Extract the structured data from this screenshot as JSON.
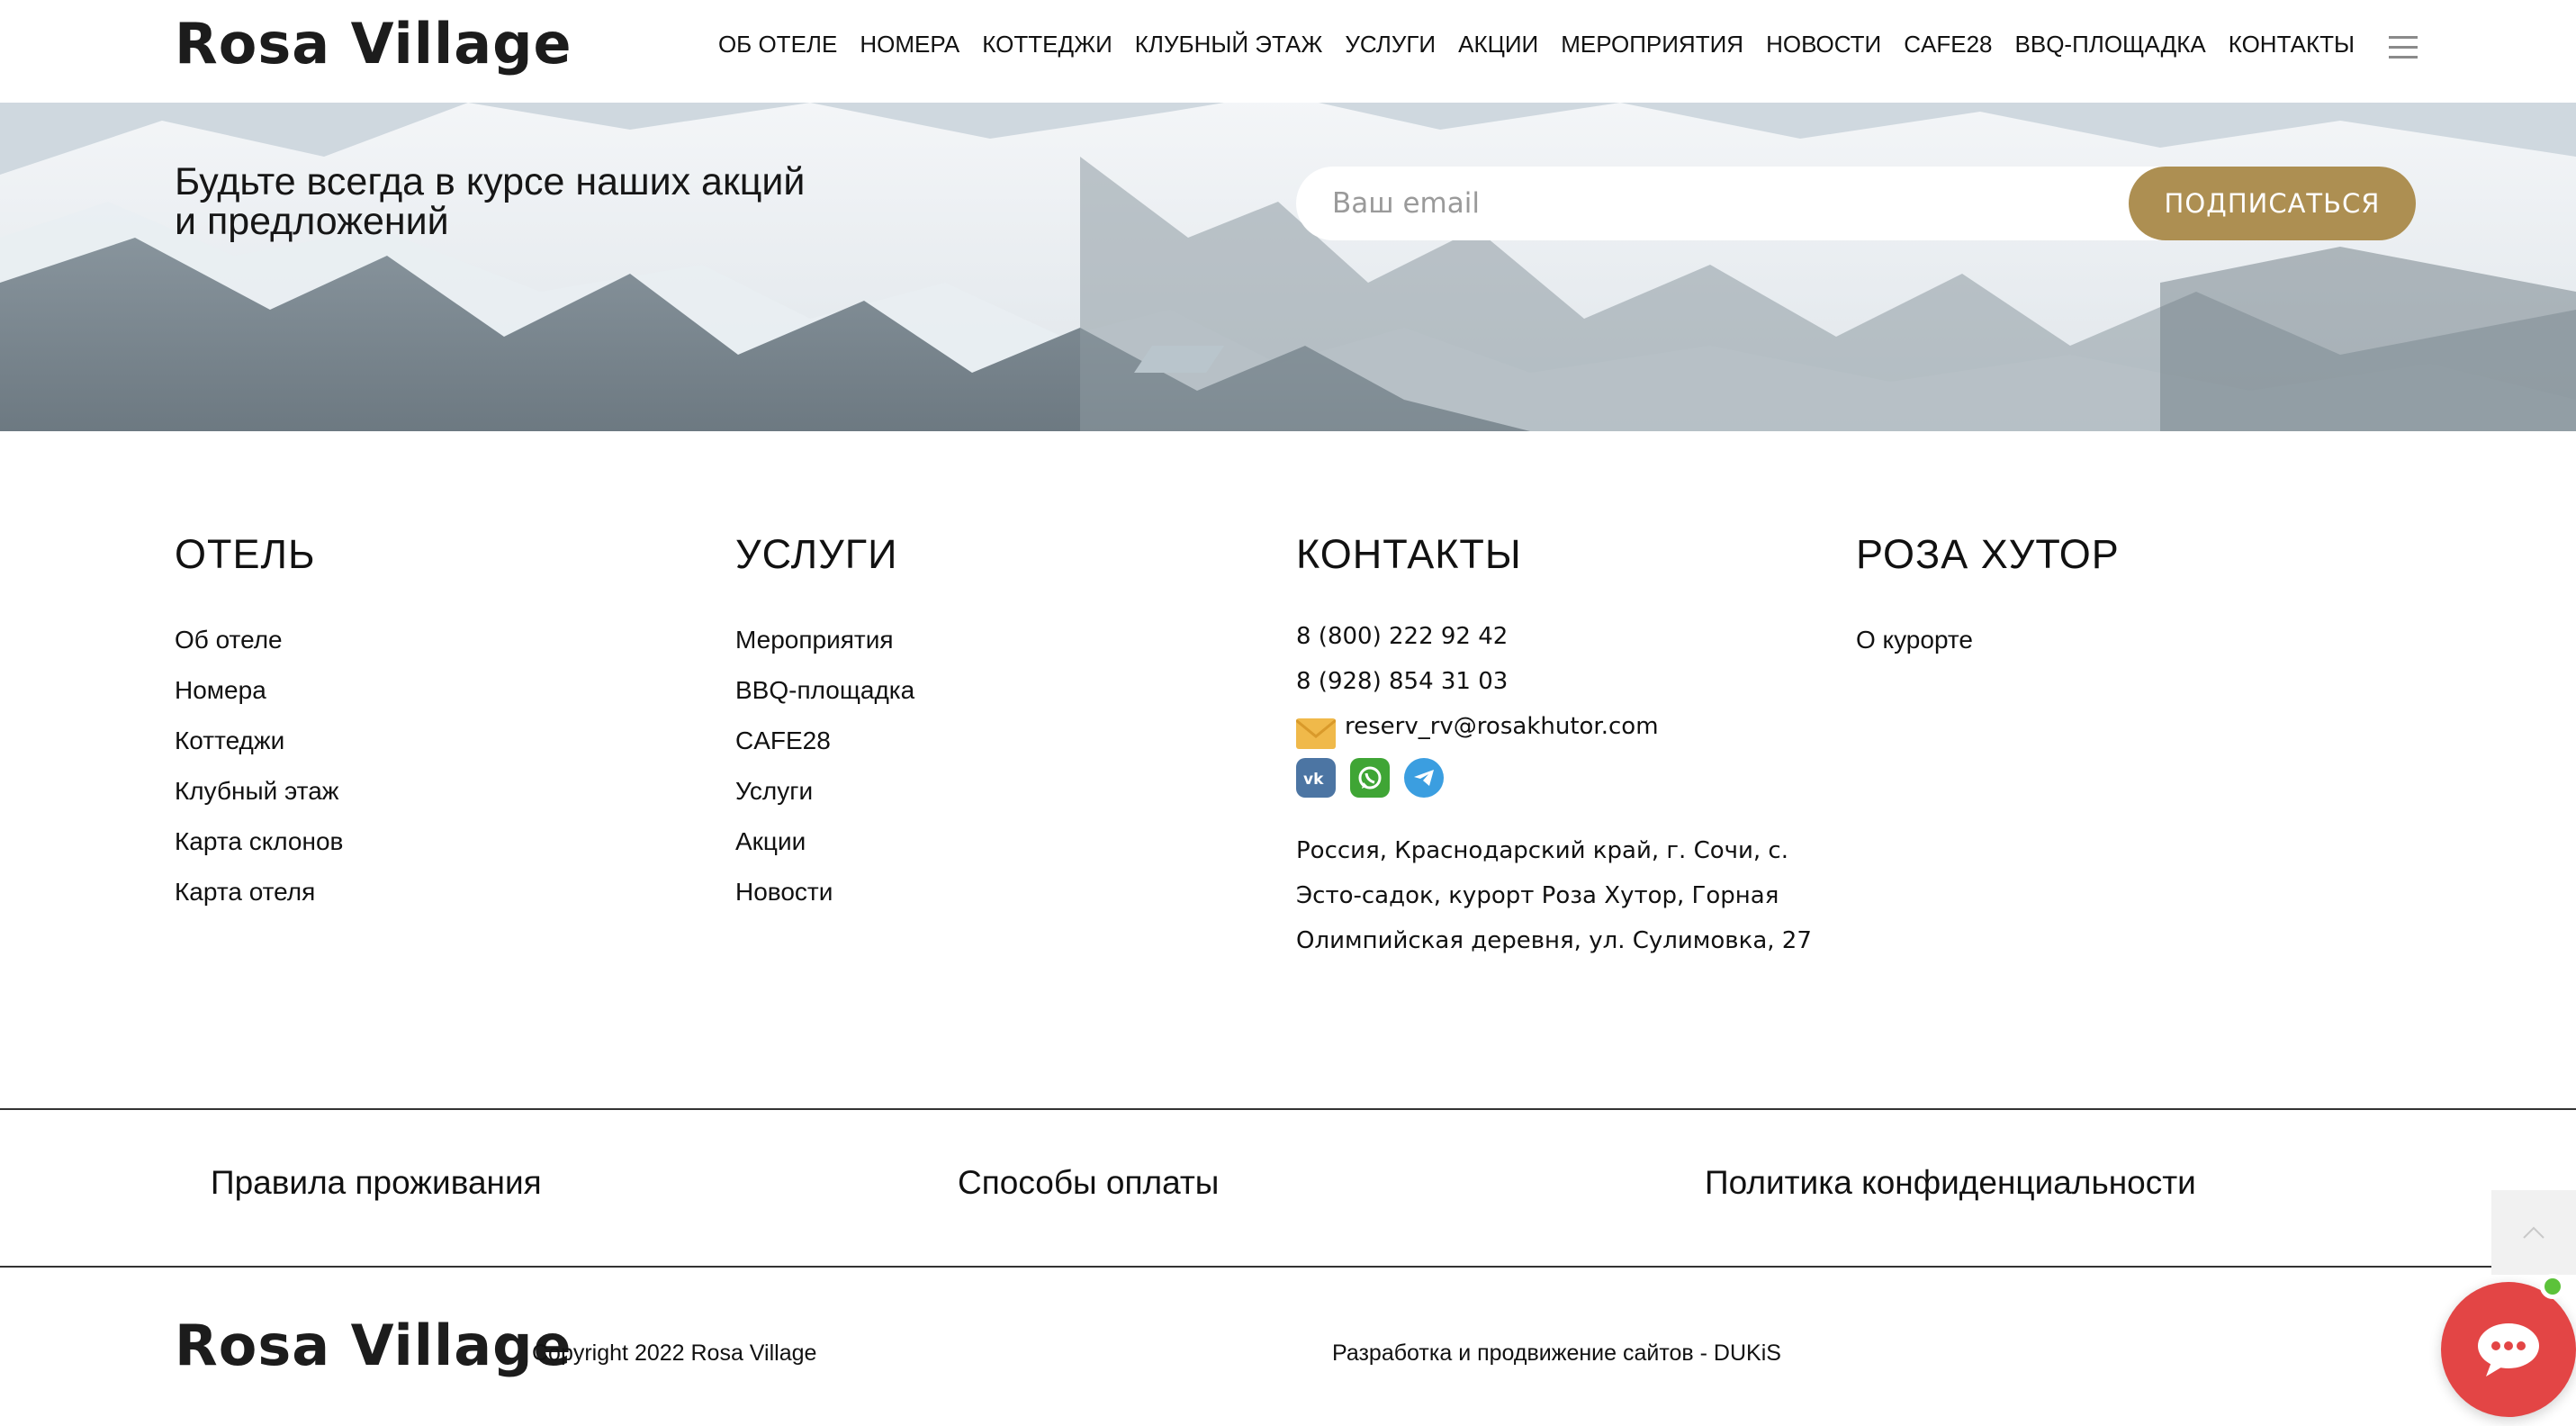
{
  "header": {
    "logo": "Rosa Village",
    "nav": [
      "ОБ ОТЕЛЕ",
      "НОМЕРА",
      "КОТТЕДЖИ",
      "КЛУБНЫЙ ЭТАЖ",
      "УСЛУГИ",
      "АКЦИИ",
      "МЕРОПРИЯТИЯ",
      "НОВОСТИ",
      "CAFE28",
      "BBQ-ПЛОЩАДКА",
      "КОНТАКТЫ"
    ],
    "menu_icon": "hamburger-icon"
  },
  "subscribe": {
    "title_line1": "Будьте всегда в курсе наших акций",
    "title_line2": "и предложений",
    "email_placeholder": "Ваш email",
    "email_value": "",
    "button_label": "ПОДПИСАТЬСЯ",
    "button_color": "#ad8f52"
  },
  "columns": {
    "hotel": {
      "title": "ОТЕЛЬ",
      "links": [
        "Об отеле",
        "Номера",
        "Коттеджи",
        "Клубный этаж",
        "Карта склонов",
        "Карта отеля"
      ]
    },
    "services": {
      "title": "УСЛУГИ",
      "links": [
        "Мероприятия",
        "BBQ-площадка",
        "CAFE28",
        "Услуги",
        "Акции",
        "Новости"
      ]
    },
    "contacts": {
      "title": "КОНТАКТЫ",
      "phone1": "8 (800) 222 92 42",
      "phone2": "8 (928) 854 31 03",
      "email": "reserv_rv@rosakhutor.com",
      "socials": [
        "vk-icon",
        "whatsapp-icon",
        "telegram-icon"
      ],
      "address": "Россия, Краснодарский край, г. Сочи, с. Эсто-садок, курорт Роза Хутор, Горная Олимпийская деревня, ул. Сулимовка, 27"
    },
    "rosa": {
      "title": "РОЗА ХУТОР",
      "links": [
        "О курорте"
      ]
    }
  },
  "legal": {
    "rules": "Правила проживания",
    "payment": "Способы оплаты",
    "privacy": "Политика конфиденциальности"
  },
  "bottom": {
    "logo": "Rosa Village",
    "copyright": "Copyright 2022 Rosa Village",
    "developer": "Разработка и продвижение сайтов - DUKiS"
  },
  "colors": {
    "accent": "#ad8f52",
    "chat": "#e34545",
    "online": "#5cc23a"
  }
}
